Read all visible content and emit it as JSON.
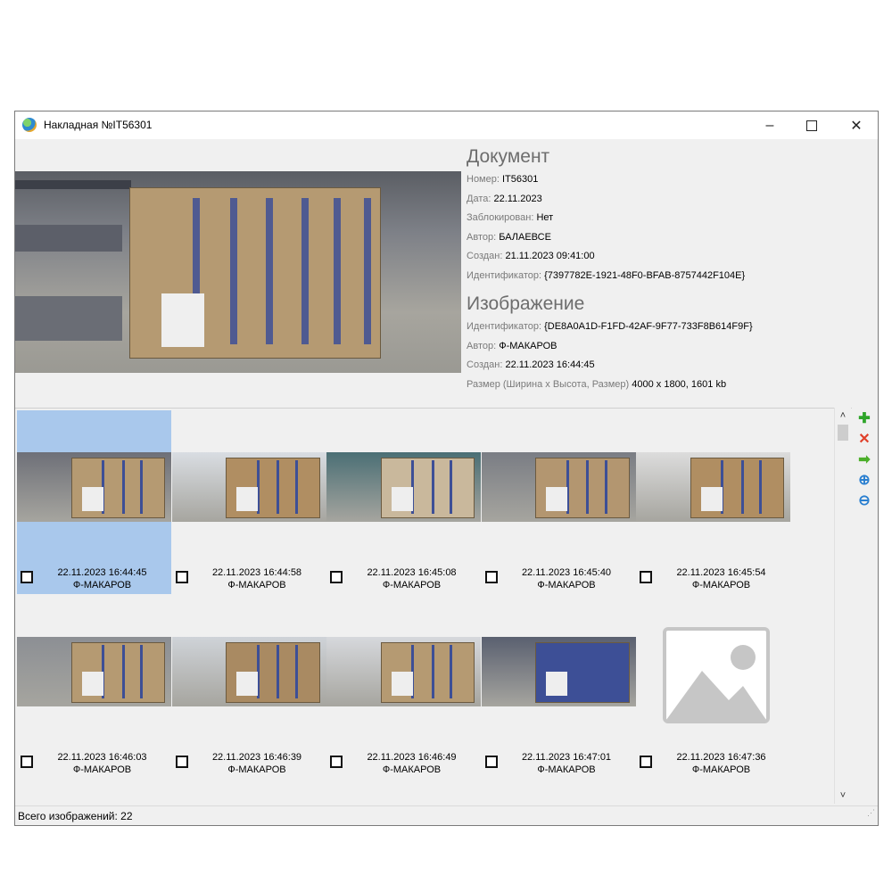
{
  "window": {
    "title": "Накладная №IT56301",
    "minimize": "–",
    "close": "✕"
  },
  "document": {
    "heading": "Документ",
    "fields": [
      {
        "label": "Номер:",
        "value": "IT56301"
      },
      {
        "label": "Дата:",
        "value": "22.11.2023"
      },
      {
        "label": "Заблокирован:",
        "value": "Нет"
      },
      {
        "label": "Автор:",
        "value": "БАЛАЕВСЕ"
      },
      {
        "label": "Создан:",
        "value": "21.11.2023 09:41:00"
      },
      {
        "label": "Идентификатор:",
        "value": "{7397782E-1921-48F0-BFAB-8757442F104E}"
      }
    ]
  },
  "image": {
    "heading": "Изображение",
    "fields": [
      {
        "label": "Идентификатор:",
        "value": "{DE8A0A1D-F1FD-42AF-9F77-733F8B614F9F}"
      },
      {
        "label": "Автор:",
        "value": "Ф-МАКАРОВ"
      },
      {
        "label": "Создан:",
        "value": "22.11.2023 16:44:45"
      },
      {
        "label": "Размер (Ширина x Высота, Размер)",
        "value": "4000 x 1800, 1601 kb"
      }
    ]
  },
  "thumbnails": [
    {
      "date": "22.11.2023 16:44:45",
      "author": "Ф-МАКАРОВ",
      "selected": true
    },
    {
      "date": "22.11.2023 16:44:58",
      "author": "Ф-МАКАРОВ"
    },
    {
      "date": "22.11.2023 16:45:08",
      "author": "Ф-МАКАРОВ"
    },
    {
      "date": "22.11.2023 16:45:40",
      "author": "Ф-МАКАРОВ"
    },
    {
      "date": "22.11.2023 16:45:54",
      "author": "Ф-МАКАРОВ"
    },
    {
      "date": "22.11.2023 16:46:03",
      "author": "Ф-МАКАРОВ"
    },
    {
      "date": "22.11.2023 16:46:39",
      "author": "Ф-МАКАРОВ"
    },
    {
      "date": "22.11.2023 16:46:49",
      "author": "Ф-МАКАРОВ"
    },
    {
      "date": "22.11.2023 16:47:01",
      "author": "Ф-МАКАРОВ"
    },
    {
      "date": "22.11.2023 16:47:36",
      "author": "Ф-МАКАРОВ",
      "placeholder": true
    }
  ],
  "scroll": {
    "up": "˄",
    "down": "˅"
  },
  "tools": {
    "add": "✚",
    "delete": "✕",
    "forward": "➡",
    "zoom_in": "⊕",
    "zoom_out": "⊖",
    "colors": {
      "add": "#2fa52a",
      "delete": "#e0402a",
      "forward": "#4caf2a",
      "zoom": "#2a7fd0"
    }
  },
  "status": {
    "text": "Всего изображений: 22"
  }
}
